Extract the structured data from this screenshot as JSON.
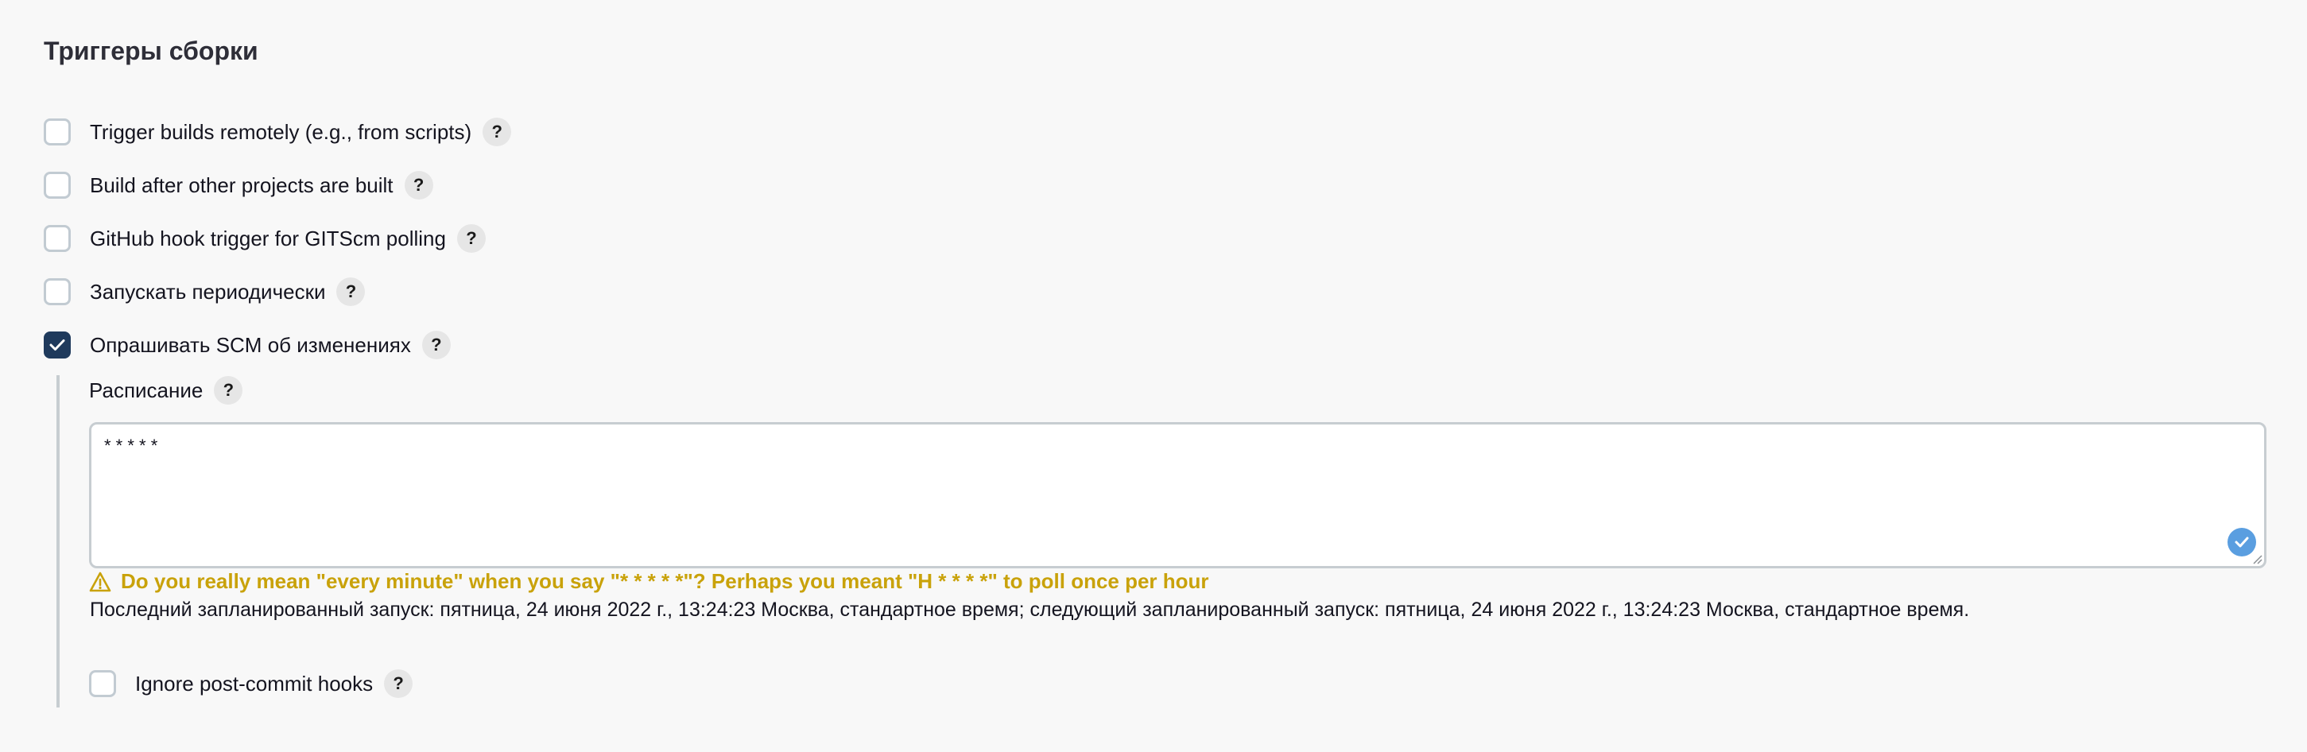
{
  "section": {
    "title": "Триггеры сборки"
  },
  "triggers": [
    {
      "label": "Trigger builds remotely (e.g., from scripts)",
      "checked": false,
      "help": "?"
    },
    {
      "label": "Build after other projects are built",
      "checked": false,
      "help": "?"
    },
    {
      "label": "GitHub hook trigger for GITScm polling",
      "checked": false,
      "help": "?"
    },
    {
      "label": "Запускать периодически",
      "checked": false,
      "help": "?"
    },
    {
      "label": "Опрашивать SCM об изменениях",
      "checked": true,
      "help": "?"
    }
  ],
  "schedule": {
    "label": "Расписание",
    "help": "?",
    "value": "* * * * *",
    "warning": "Do you really mean \"every minute\" when you say \"* * * * *\"? Perhaps you meant \"H * * * *\" to poll once per hour",
    "info": "Последний запланированный запуск: пятница, 24 июня 2022 г., 13:24:23 Москва, стандартное время; следующий запланированный запуск: пятница, 24 июня 2022 г., 13:24:23 Москва, стандартное время."
  },
  "ignore_hooks": {
    "label": "Ignore post-commit hooks",
    "checked": false,
    "help": "?"
  },
  "colors": {
    "checked_bg": "#1f3a5c",
    "warning": "#c9a20a",
    "valid_icon": "#5a9ee0"
  }
}
